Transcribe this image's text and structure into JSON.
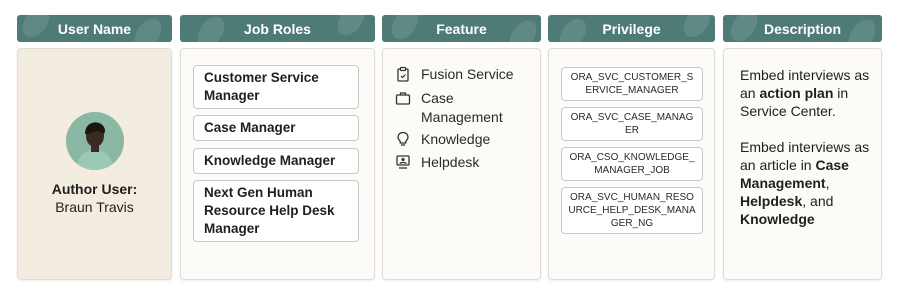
{
  "headers": {
    "user": "User Name",
    "roles": "Job Roles",
    "feature": "Feature",
    "privilege": "Privilege",
    "description": "Description"
  },
  "user": {
    "role_label": "Author User:",
    "name": "Braun Travis"
  },
  "job_roles": [
    "Customer Service Manager",
    "Case Manager",
    "Knowledge Manager",
    "Next Gen Human Resource Help Desk Manager"
  ],
  "features": [
    {
      "label": "Fusion Service",
      "icon": "clipboard-icon"
    },
    {
      "label": "Case Management",
      "icon": "briefcase-icon"
    },
    {
      "label": "Knowledge",
      "icon": "lightbulb-icon"
    },
    {
      "label": "Helpdesk",
      "icon": "helpdesk-icon"
    }
  ],
  "privileges": [
    "ORA_SVC_CUSTOMER_SERVICE_MANAGER",
    "ORA_SVC_CASE_MANAGER",
    "ORA_CSO_KNOWLEDGE_MANAGER_JOB",
    "ORA_SVC_HUMAN_RESOURCE_HELP_DESK_MANAGER_NG"
  ],
  "description": {
    "p1_pre": "Embed interviews as an ",
    "p1_bold": "action plan",
    "p1_post": " in Service Center.",
    "p2_pre": "Embed interviews as an article in ",
    "p2_bold1": "Case Management",
    "p2_sep1": ", ",
    "p2_bold2": "Helpdesk",
    "p2_sep2": ", and ",
    "p2_bold3": "Knowledge"
  },
  "colors": {
    "header_bg": "#4f7b76",
    "user_panel_bg": "#f3ede1",
    "panel_bg": "#fcfbf8",
    "avatar_bg": "#8bb8a4"
  }
}
